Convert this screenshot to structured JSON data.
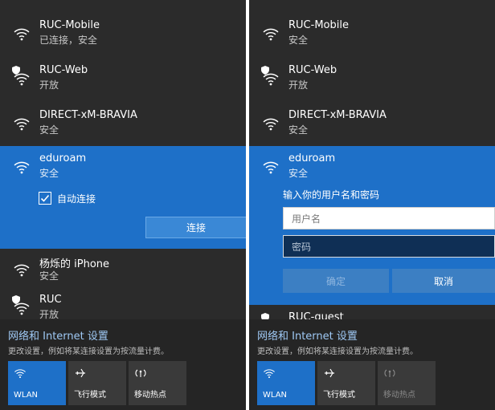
{
  "left": {
    "networks": [
      {
        "name": "RUC-Mobile",
        "status": "已连接，安全",
        "secured": false
      },
      {
        "name": "RUC-Web",
        "status": "开放",
        "secured": true
      },
      {
        "name": "DIRECT-xM-BRAVIA",
        "status": "安全",
        "secured": false
      }
    ],
    "expanded": {
      "name": "eduroam",
      "status": "安全",
      "auto_connect_label": "自动连接",
      "auto_connect_checked": true,
      "connect_label": "连接"
    },
    "networks_below": [
      {
        "name": "杨烁的 iPhone",
        "status": "安全",
        "secured": false
      },
      {
        "name": "RUC",
        "status": "开放",
        "secured": true
      }
    ]
  },
  "right": {
    "networks": [
      {
        "name": "RUC-Mobile",
        "status": "安全",
        "secured": false
      },
      {
        "name": "RUC-Web",
        "status": "开放",
        "secured": true
      },
      {
        "name": "DIRECT-xM-BRAVIA",
        "status": "安全",
        "secured": false
      }
    ],
    "expanded": {
      "name": "eduroam",
      "status": "安全",
      "prompt": "输入你的用户名和密码",
      "username_placeholder": "用户名",
      "password_placeholder": "密码",
      "ok_label": "确定",
      "cancel_label": "取消"
    },
    "networks_below": [
      {
        "name": "RUC-guest",
        "status": "",
        "secured": true
      }
    ]
  },
  "footer": {
    "settings_link": "网络和 Internet 设置",
    "settings_desc": "更改设置，例如将某连接设置为按流量计费。",
    "tiles": [
      {
        "label": "WLAN",
        "icon": "wifi-icon",
        "active": true
      },
      {
        "label": "飞行模式",
        "icon": "airplane-icon",
        "active": false
      },
      {
        "label": "移动热点",
        "icon": "hotspot-icon",
        "active": false
      }
    ]
  },
  "colors": {
    "panel_bg": "#2b2b2b",
    "accent": "#1e70c8",
    "link": "#9fc9f5"
  }
}
